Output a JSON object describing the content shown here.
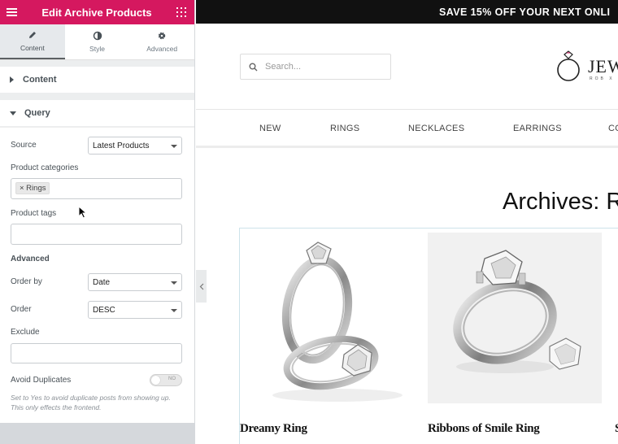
{
  "panel": {
    "title": "Edit Archive Products",
    "tabs": [
      {
        "label": "Content",
        "icon": "pencil-icon",
        "active": true
      },
      {
        "label": "Style",
        "icon": "contrast-icon",
        "active": false
      },
      {
        "label": "Advanced",
        "icon": "gear-icon",
        "active": false
      }
    ],
    "sections": {
      "content": "Content",
      "query": "Query"
    },
    "query": {
      "source_label": "Source",
      "source_value": "Latest Products",
      "categories_label": "Product categories",
      "categories_tag": "× Rings",
      "tags_label": "Product tags",
      "advanced_label": "Advanced",
      "orderby_label": "Order by",
      "orderby_value": "Date",
      "order_label": "Order",
      "order_value": "DESC",
      "exclude_label": "Exclude",
      "avoid_label": "Avoid Duplicates",
      "avoid_toggle": "NO",
      "help_text": "Set to Yes to avoid duplicate posts from showing up. This only effects the frontend."
    }
  },
  "site": {
    "promo": "SAVE 15% OFF YOUR NEXT ONLI",
    "search_placeholder": "Search...",
    "logo_text": "JEW",
    "logo_sub": "ROB X",
    "nav": [
      "NEW",
      "RINGS",
      "NECKLACES",
      "EARRINGS",
      "CO"
    ],
    "archive_title": "Archives: R",
    "products": [
      {
        "name": "Dreamy Ring"
      },
      {
        "name": "Ribbons of Smile Ring"
      },
      {
        "name": "S"
      }
    ]
  },
  "colors": {
    "accent": "#d5185f",
    "promo_bg": "#111111"
  }
}
